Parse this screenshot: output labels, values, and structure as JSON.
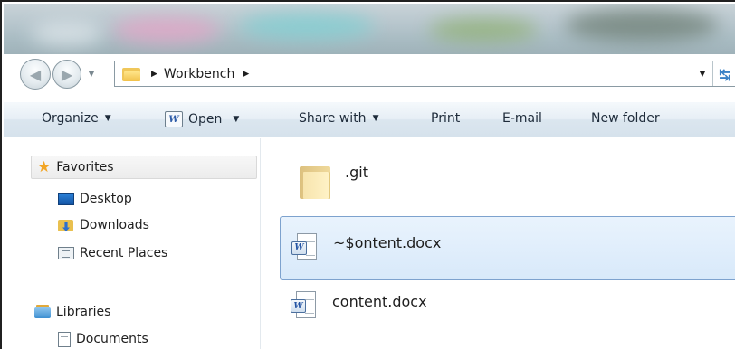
{
  "address_bar": {
    "crumbs": [
      "Workbench"
    ],
    "icons": {
      "back": "back-arrow-icon",
      "forward": "forward-arrow-icon",
      "refresh": "refresh-icon"
    }
  },
  "toolbar": {
    "organize": "Organize",
    "open": "Open",
    "share_with": "Share with",
    "print": "Print",
    "email": "E-mail",
    "new_folder": "New folder"
  },
  "nav_pane": {
    "favorites": "Favorites",
    "desktop": "Desktop",
    "downloads": "Downloads",
    "recent_places": "Recent Places",
    "libraries": "Libraries",
    "documents": "Documents"
  },
  "files": [
    {
      "name": ".git",
      "type": "folder",
      "selected": false
    },
    {
      "name": "~$ontent.docx",
      "type": "word-document",
      "selected": true
    },
    {
      "name": "content.docx",
      "type": "word-document",
      "selected": false
    }
  ],
  "colors": {
    "selection_fill": "#d8e9fa",
    "selection_border": "#7da2ce",
    "toolbar_bg": "#dbe6ef",
    "star": "#f2a524"
  }
}
